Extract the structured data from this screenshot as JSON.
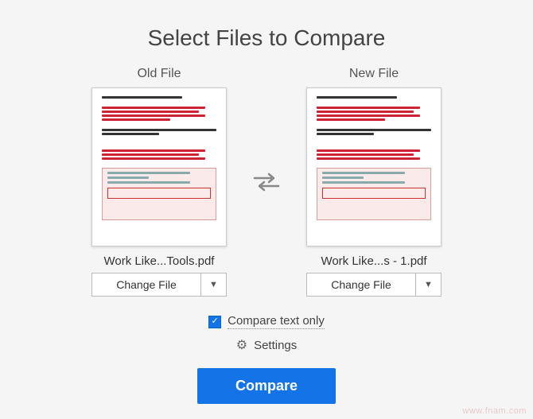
{
  "title": "Select Files to Compare",
  "old": {
    "label": "Old File",
    "filename": "Work Like...Tools.pdf",
    "change_label": "Change File"
  },
  "new": {
    "label": "New File",
    "filename": "Work Like...s - 1.pdf",
    "change_label": "Change File"
  },
  "options": {
    "compare_text_only": "Compare text only",
    "compare_text_only_checked": true,
    "settings_label": "Settings"
  },
  "compare_button": "Compare",
  "watermark": "www.fnam.com"
}
